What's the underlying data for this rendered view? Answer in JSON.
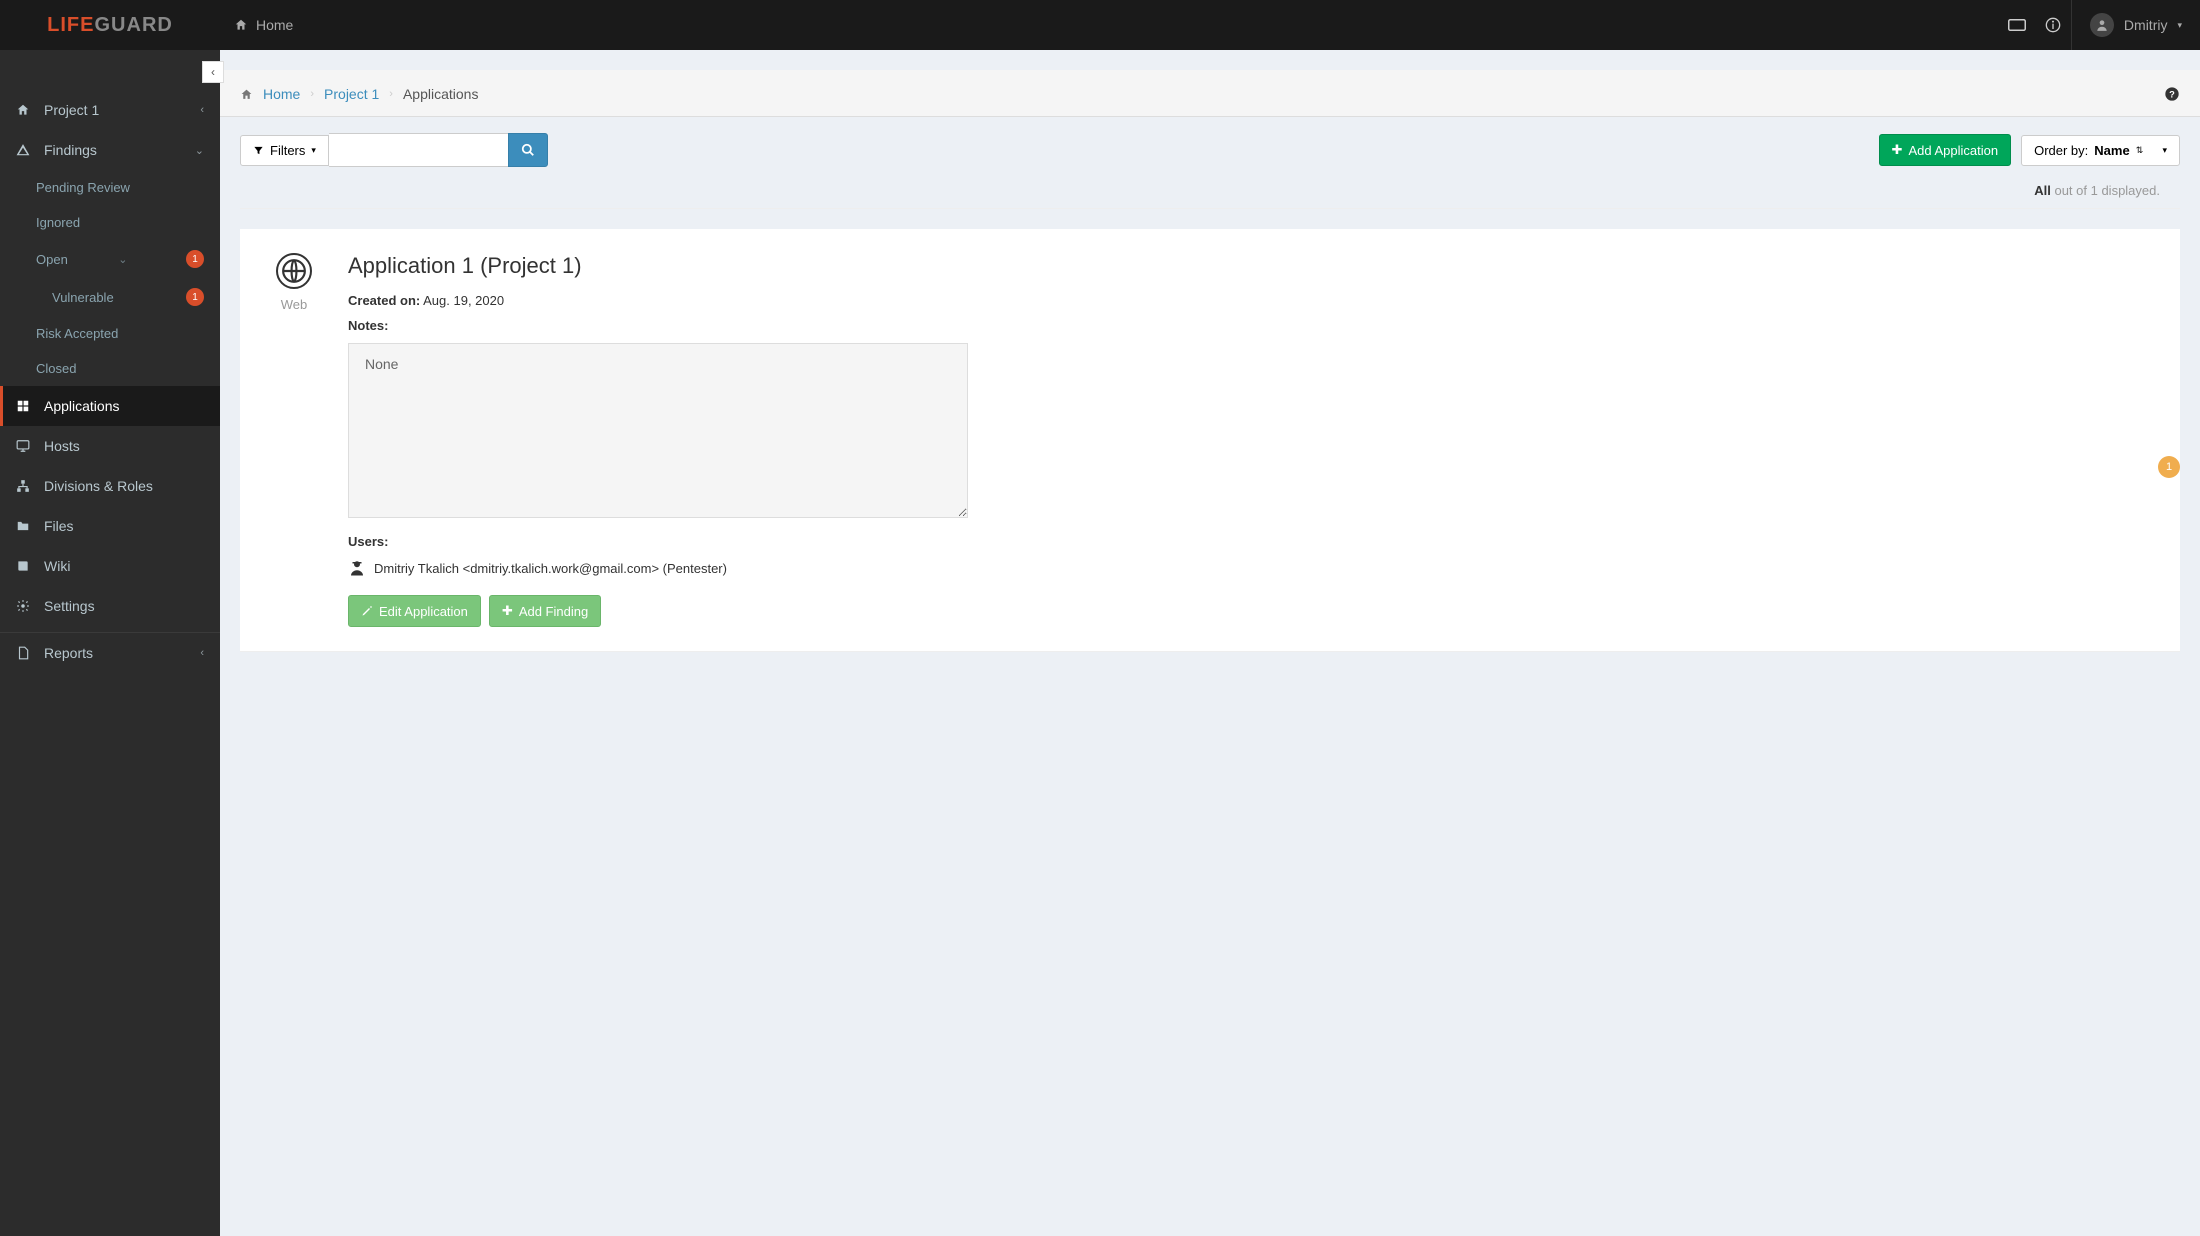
{
  "brand": {
    "part1": "LIFE",
    "part2": "GUARD"
  },
  "topnav": {
    "home": "Home"
  },
  "user": {
    "name": "Dmitriy"
  },
  "sidebar": {
    "project": "Project 1",
    "findings": "Findings",
    "sub": {
      "pending": "Pending Review",
      "ignored": "Ignored",
      "open": "Open",
      "open_count": "1",
      "vulnerable": "Vulnerable",
      "vulnerable_count": "1",
      "risk": "Risk Accepted",
      "closed": "Closed"
    },
    "applications": "Applications",
    "hosts": "Hosts",
    "divisions": "Divisions & Roles",
    "files": "Files",
    "wiki": "Wiki",
    "settings": "Settings",
    "reports": "Reports"
  },
  "breadcrumb": {
    "home": "Home",
    "project": "Project 1",
    "current": "Applications"
  },
  "toolbar": {
    "filters": "Filters",
    "add_app": "Add Application",
    "order_prefix": "Order by: ",
    "order_field": "Name"
  },
  "count": {
    "bold": "All",
    "rest": " out of 1 displayed."
  },
  "app": {
    "title": "Application 1 (Project 1)",
    "type_label": "Web",
    "created_label": "Created on:",
    "created_value": " Aug. 19, 2020",
    "notes_label": "Notes:",
    "notes_value": "None",
    "users_label": "Users:",
    "user_entry": "Dmitriy Tkalich <dmitriy.tkalich.work@gmail.com> (Pentester)",
    "edit": "Edit Application",
    "add_finding": "Add Finding"
  },
  "float_badge": "1"
}
